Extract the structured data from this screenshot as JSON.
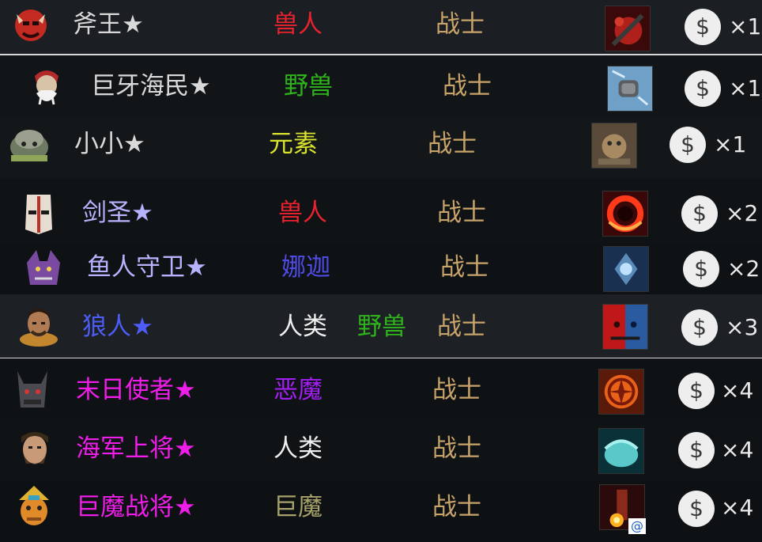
{
  "colors": {
    "name_white": "#d9d9d9",
    "name_lavender": "#b7b3ff",
    "name_blue": "#4d5df7",
    "name_magenta": "#ee1ee8",
    "race_red": "#e8232e",
    "race_green": "#2fb41b",
    "race_yellow": "#d9e22c",
    "race_indigo": "#4f4be6",
    "race_purple": "#a21ff1",
    "race_white": "#efefef",
    "race_olive": "#a6a26a",
    "class_tan": "#c9a46a"
  },
  "heroes": [
    {
      "name": "斧王★",
      "races": [
        "兽人"
      ],
      "race_colors": [
        "race_red"
      ],
      "class": "战士",
      "cost": "×1",
      "coin": "$",
      "name_color": "name_white",
      "portrait_icon": "axe-portrait-icon",
      "skill_icon": "berserkers-call-icon"
    },
    {
      "name": "巨牙海民★",
      "races": [
        "野兽"
      ],
      "race_colors": [
        "race_green"
      ],
      "class": "战士",
      "cost": "×1",
      "coin": "$",
      "name_color": "name_white",
      "portrait_icon": "tusk-portrait-icon",
      "skill_icon": "walrus-punch-icon"
    },
    {
      "name": "小小★",
      "races": [
        "元素"
      ],
      "race_colors": [
        "race_yellow"
      ],
      "class": "战士",
      "cost": "×1",
      "coin": "$",
      "name_color": "name_white",
      "portrait_icon": "tiny-portrait-icon",
      "skill_icon": "grow-icon"
    },
    {
      "name": "剑圣★",
      "races": [
        "兽人"
      ],
      "race_colors": [
        "race_red"
      ],
      "class": "战士",
      "cost": "×2",
      "coin": "$",
      "name_color": "name_lavender",
      "portrait_icon": "juggernaut-portrait-icon",
      "skill_icon": "blade-fury-icon"
    },
    {
      "name": "鱼人守卫★",
      "races": [
        "娜迦"
      ],
      "race_colors": [
        "race_indigo"
      ],
      "class": "战士",
      "cost": "×2",
      "coin": "$",
      "name_color": "name_lavender",
      "portrait_icon": "slardar-portrait-icon",
      "skill_icon": "slithereen-crush-icon"
    },
    {
      "name": "狼人★",
      "races": [
        "人类",
        "野兽"
      ],
      "race_colors": [
        "race_white",
        "race_green"
      ],
      "class": "战士",
      "cost": "×3",
      "coin": "$",
      "name_color": "name_blue",
      "portrait_icon": "lycan-portrait-icon",
      "skill_icon": "shapeshift-icon"
    },
    {
      "name": "末日使者★",
      "races": [
        "恶魔"
      ],
      "race_colors": [
        "race_purple"
      ],
      "class": "战士",
      "cost": "×4",
      "coin": "$",
      "name_color": "name_magenta",
      "portrait_icon": "doom-portrait-icon",
      "skill_icon": "doom-icon"
    },
    {
      "name": "海军上将★",
      "races": [
        "人类"
      ],
      "race_colors": [
        "race_white"
      ],
      "class": "战士",
      "cost": "×4",
      "coin": "$",
      "name_color": "name_magenta",
      "portrait_icon": "kunkka-portrait-icon",
      "skill_icon": "ghostship-icon"
    },
    {
      "name": "巨魔战将★",
      "races": [
        "巨魔"
      ],
      "race_colors": [
        "race_olive"
      ],
      "class": "战士",
      "cost": "×4",
      "coin": "$",
      "name_color": "name_magenta",
      "portrait_icon": "troll-warlord-portrait-icon",
      "skill_icon": "battle-trance-icon"
    }
  ],
  "watermark": "@"
}
